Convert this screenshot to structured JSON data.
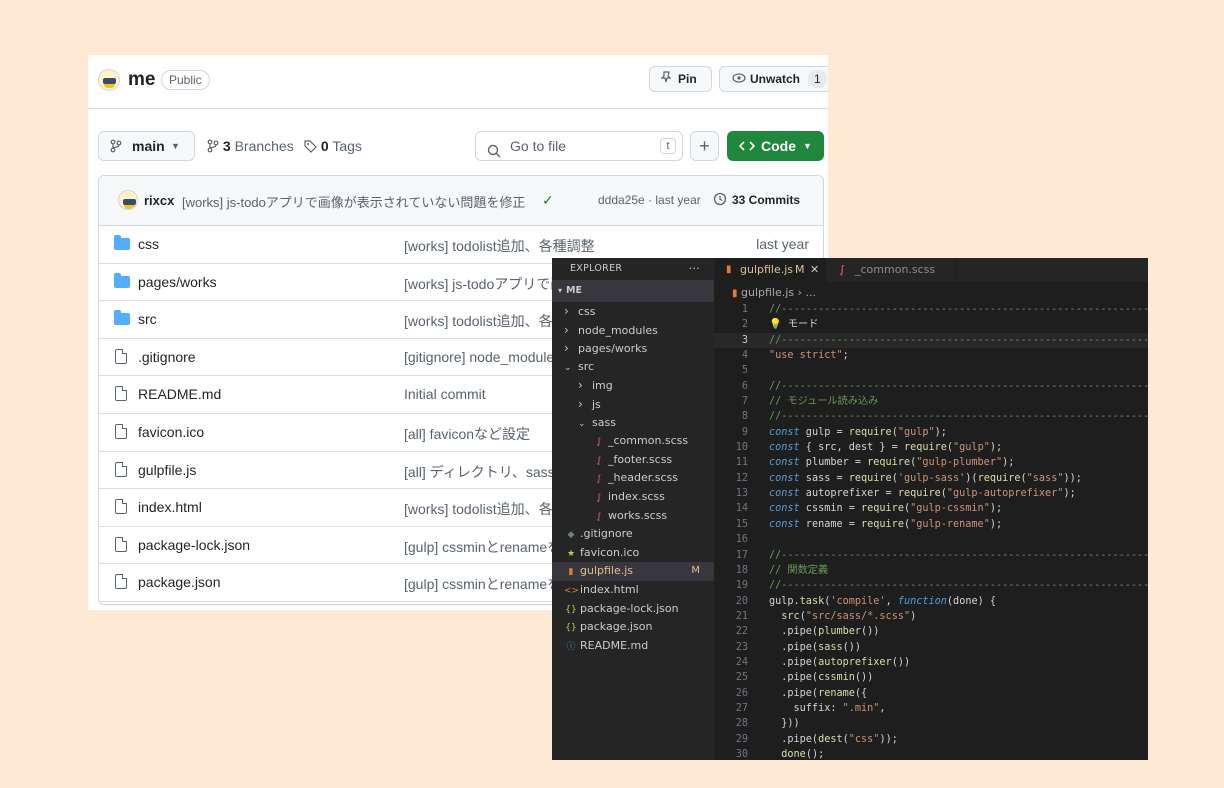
{
  "github": {
    "repo_name": "me",
    "visibility": "Public",
    "pin_label": "Pin",
    "unwatch_label": "Unwatch",
    "watch_count": "1",
    "branch": "main",
    "branches_count": "3",
    "branches_label": "Branches",
    "tags_count": "0",
    "tags_label": "Tags",
    "goto_placeholder": "Go to file",
    "goto_shortcut": "t",
    "add_label": "+",
    "code_label": "Code",
    "commit": {
      "author": "rixcx",
      "message": "[works] js-todoアプリで画像が表示されていない問題を修正",
      "hash_time": "ddda25e · last year",
      "commits_count": "33 Commits"
    },
    "files": [
      {
        "name": "css",
        "type": "folder",
        "message": "[works] todolist追加、各種調整",
        "date": "last year"
      },
      {
        "name": "pages/works",
        "type": "folder",
        "message": "[works] js-todoアプリで画",
        "date": ""
      },
      {
        "name": "src",
        "type": "folder",
        "message": "[works] todolist追加、各種",
        "date": ""
      },
      {
        "name": ".gitignore",
        "type": "file",
        "message": "[gitignore] node_modules",
        "date": ""
      },
      {
        "name": "README.md",
        "type": "file",
        "message": "Initial commit",
        "date": ""
      },
      {
        "name": "favicon.ico",
        "type": "file",
        "message": "[all] faviconなど設定",
        "date": ""
      },
      {
        "name": "gulpfile.js",
        "type": "file",
        "message": "[all] ディレクトリ、sass構",
        "date": ""
      },
      {
        "name": "index.html",
        "type": "file",
        "message": "[works] todolist追加、各種",
        "date": ""
      },
      {
        "name": "package-lock.json",
        "type": "file",
        "message": "[gulp] cssminとrenameを",
        "date": ""
      },
      {
        "name": "package.json",
        "type": "file",
        "message": "[gulp] cssminとrenameを",
        "date": ""
      }
    ]
  },
  "vscode": {
    "explorer_title": "EXPLORER",
    "explorer_more": "···",
    "root": "ME",
    "tree": [
      {
        "label": "css",
        "depth": 1,
        "kind": "folder-closed",
        "icon": "chevron-right-icon"
      },
      {
        "label": "node_modules",
        "depth": 1,
        "kind": "folder-closed",
        "icon": "chevron-right-icon"
      },
      {
        "label": "pages/works",
        "depth": 1,
        "kind": "folder-closed",
        "icon": "chevron-right-icon"
      },
      {
        "label": "src",
        "depth": 1,
        "kind": "folder-open",
        "icon": "chevron-down-icon"
      },
      {
        "label": "img",
        "depth": 2,
        "kind": "folder-closed",
        "icon": "chevron-right-icon"
      },
      {
        "label": "js",
        "depth": 2,
        "kind": "folder-closed",
        "icon": "chevron-right-icon"
      },
      {
        "label": "sass",
        "depth": 2,
        "kind": "folder-open",
        "icon": "chevron-down-icon"
      },
      {
        "label": "_common.scss",
        "depth": 3,
        "kind": "sass",
        "icon": "sass-icon"
      },
      {
        "label": "_footer.scss",
        "depth": 3,
        "kind": "sass",
        "icon": "sass-icon"
      },
      {
        "label": "_header.scss",
        "depth": 3,
        "kind": "sass",
        "icon": "sass-icon"
      },
      {
        "label": "index.scss",
        "depth": 3,
        "kind": "sass",
        "icon": "sass-icon"
      },
      {
        "label": "works.scss",
        "depth": 3,
        "kind": "sass",
        "icon": "sass-icon"
      },
      {
        "label": ".gitignore",
        "depth": 1,
        "kind": "git",
        "icon": "git-icon"
      },
      {
        "label": "favicon.ico",
        "depth": 1,
        "kind": "star",
        "icon": "star-icon"
      },
      {
        "label": "gulpfile.js",
        "depth": 1,
        "kind": "gulp",
        "icon": "gulp-icon",
        "selected": true,
        "badge": "M"
      },
      {
        "label": "index.html",
        "depth": 1,
        "kind": "html",
        "icon": "html-icon"
      },
      {
        "label": "package-lock.json",
        "depth": 1,
        "kind": "json",
        "icon": "json-icon"
      },
      {
        "label": "package.json",
        "depth": 1,
        "kind": "json",
        "icon": "json-icon"
      },
      {
        "label": "README.md",
        "depth": 1,
        "kind": "info",
        "icon": "info-icon"
      }
    ],
    "tabs": [
      {
        "label": "gulpfile.js",
        "badge": "M",
        "active": true
      },
      {
        "label": "_common.scss",
        "active": false
      }
    ],
    "breadcrumb": "gulpfile.js",
    "breadcrumb_more": "...",
    "current_line": 3,
    "code_lines": [
      "//---------------------------------------------------------------",
      "💡 モード",
      "//---------------------------------------------------------------",
      "\"use strict\";",
      "",
      "//---------------------------------------------------------------",
      "// モジュール読み込み",
      "//---------------------------------------------------------------",
      "const gulp = require(\"gulp\");",
      "const { src, dest } = require(\"gulp\");",
      "const plumber = require(\"gulp-plumber\");",
      "const sass = require('gulp-sass')(require(\"sass\"));",
      "const autoprefixer = require(\"gulp-autoprefixer\");",
      "const cssmin = require(\"gulp-cssmin\");",
      "const rename = require(\"gulp-rename\");",
      "",
      "//---------------------------------------------------------------",
      "// 関数定義",
      "//---------------------------------------------------------------",
      "gulp.task('compile', function(done) {",
      "  src(\"src/sass/*.scss\")",
      "  .pipe(plumber())",
      "  .pipe(sass())",
      "  .pipe(autoprefixer())",
      "  .pipe(cssmin())",
      "  .pipe(rename({",
      "    suffix: \".min\",",
      "  }))",
      "  .pipe(dest(\"css\"));",
      "  done();"
    ]
  }
}
